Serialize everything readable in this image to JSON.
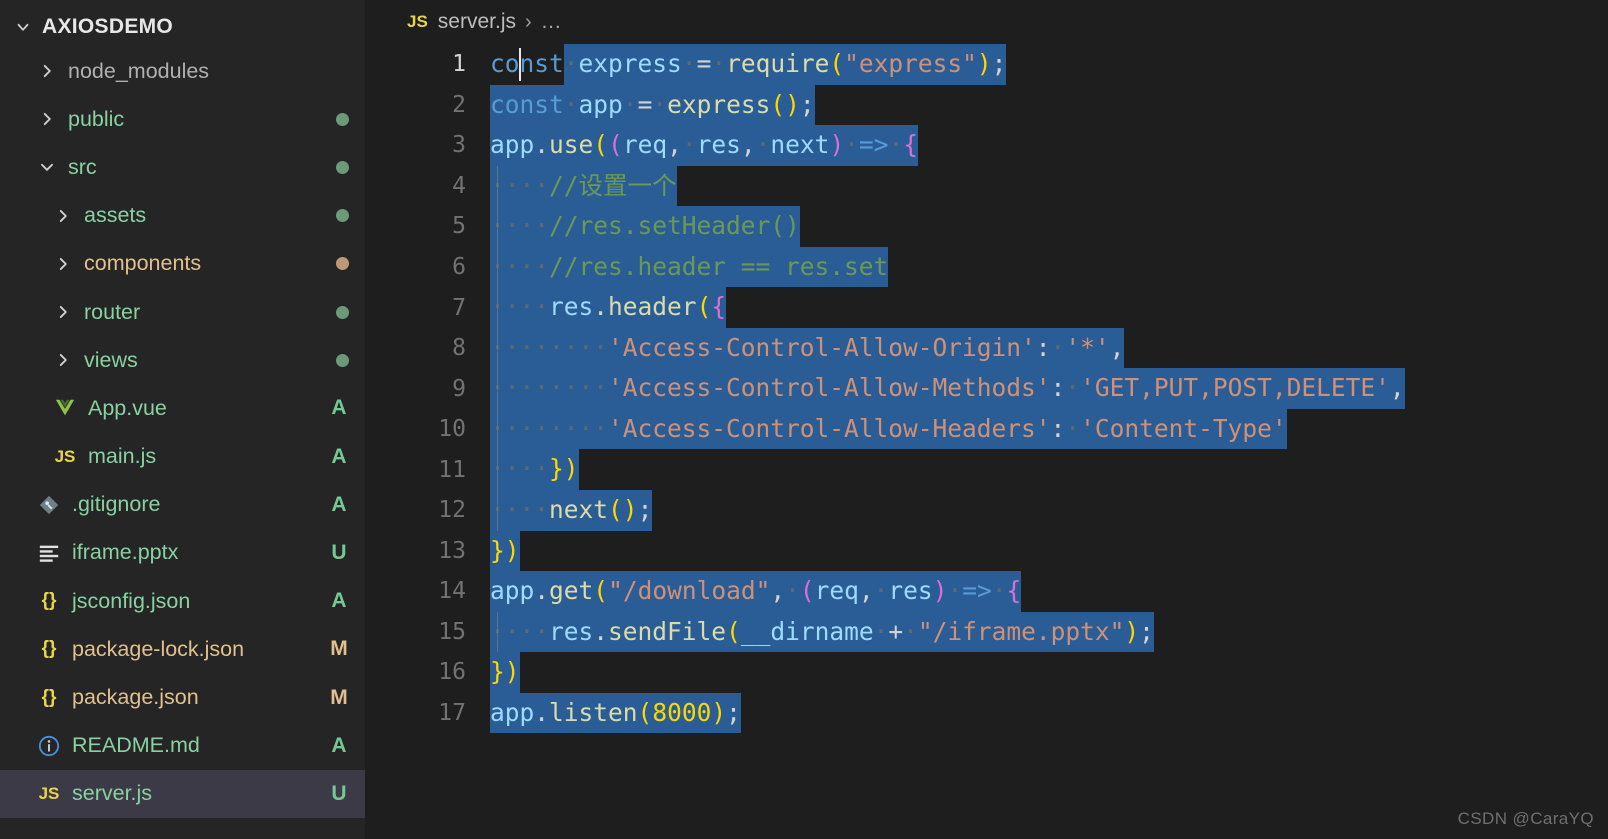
{
  "sidebar": {
    "root_label": "AXIOSDEMO",
    "root_twisty": "chevron-down-icon",
    "items": [
      {
        "label": "node_modules",
        "type": "folder",
        "twisty": "chevron-right-icon",
        "indent": 1,
        "name_color": "#b0b0b0",
        "dot": null,
        "status": null,
        "icon": null,
        "selected": false
      },
      {
        "label": "public",
        "type": "folder",
        "twisty": "chevron-right-icon",
        "indent": 1,
        "name_color": "#89d1a0",
        "dot": "#6a9a78",
        "status": null,
        "icon": null,
        "selected": false
      },
      {
        "label": "src",
        "type": "folder",
        "twisty": "chevron-down-icon",
        "indent": 1,
        "name_color": "#89d1a0",
        "dot": "#6a9a78",
        "status": null,
        "icon": null,
        "selected": false
      },
      {
        "label": "assets",
        "type": "folder",
        "twisty": "chevron-right-icon",
        "indent": 2,
        "name_color": "#89d1a0",
        "dot": "#6a9a78",
        "status": null,
        "icon": null,
        "selected": false
      },
      {
        "label": "components",
        "type": "folder",
        "twisty": "chevron-right-icon",
        "indent": 2,
        "name_color": "#e2c08d",
        "dot": "#bf9875",
        "status": null,
        "icon": null,
        "selected": false
      },
      {
        "label": "router",
        "type": "folder",
        "twisty": "chevron-right-icon",
        "indent": 2,
        "name_color": "#89d1a0",
        "dot": "#6a9a78",
        "status": null,
        "icon": null,
        "selected": false
      },
      {
        "label": "views",
        "type": "folder",
        "twisty": "chevron-right-icon",
        "indent": 2,
        "name_color": "#89d1a0",
        "dot": "#6a9a78",
        "status": null,
        "icon": null,
        "selected": false
      },
      {
        "label": "App.vue",
        "type": "file",
        "twisty": null,
        "indent": 2,
        "name_color": "#89d1a0",
        "dot": null,
        "status": "A",
        "status_color": "#73c991",
        "icon": "vue-icon",
        "selected": false
      },
      {
        "label": "main.js",
        "type": "file",
        "twisty": null,
        "indent": 2,
        "name_color": "#89d1a0",
        "dot": null,
        "status": "A",
        "status_color": "#73c991",
        "icon": "js-icon",
        "selected": false
      },
      {
        "label": ".gitignore",
        "type": "file",
        "twisty": null,
        "indent": 1,
        "name_color": "#89d1a0",
        "dot": null,
        "status": "A",
        "status_color": "#73c991",
        "icon": "git-icon",
        "selected": false
      },
      {
        "label": "iframe.pptx",
        "type": "file",
        "twisty": null,
        "indent": 1,
        "name_color": "#89d1a0",
        "dot": null,
        "status": "U",
        "status_color": "#73c991",
        "icon": "powerpoint-icon",
        "selected": false
      },
      {
        "label": "jsconfig.json",
        "type": "file",
        "twisty": null,
        "indent": 1,
        "name_color": "#89d1a0",
        "dot": null,
        "status": "A",
        "status_color": "#73c991",
        "icon": "json-icon",
        "selected": false
      },
      {
        "label": "package-lock.json",
        "type": "file",
        "twisty": null,
        "indent": 1,
        "name_color": "#e2c08d",
        "dot": null,
        "status": "M",
        "status_color": "#e2c08d",
        "icon": "json-icon",
        "selected": false
      },
      {
        "label": "package.json",
        "type": "file",
        "twisty": null,
        "indent": 1,
        "name_color": "#e2c08d",
        "dot": null,
        "status": "M",
        "status_color": "#e2c08d",
        "icon": "json-icon",
        "selected": false
      },
      {
        "label": "README.md",
        "type": "file",
        "twisty": null,
        "indent": 1,
        "name_color": "#89d1a0",
        "dot": null,
        "status": "A",
        "status_color": "#73c991",
        "icon": "info-icon",
        "selected": false
      },
      {
        "label": "server.js",
        "type": "file",
        "twisty": null,
        "indent": 1,
        "name_color": "#89d1a0",
        "dot": null,
        "status": "U",
        "status_color": "#73c991",
        "icon": "js-icon",
        "selected": true
      }
    ]
  },
  "breadcrumb": {
    "file_icon": "js-icon",
    "file_icon_label": "JS",
    "file": "server.js",
    "separator": "›",
    "overflow": "…"
  },
  "editor": {
    "language": "javascript",
    "filename": "server.js",
    "active_line": 1,
    "cursor": {
      "line": 1,
      "column": 3
    },
    "selection_color": "#2a5d96",
    "background": "#1e1e1e",
    "line_numbers": [
      "1",
      "2",
      "3",
      "4",
      "5",
      "6",
      "7",
      "8",
      "9",
      "10",
      "11",
      "12",
      "13",
      "14",
      "15",
      "16",
      "17"
    ],
    "lines": [
      "const express = require(\"express\");",
      "const app = express();",
      "app.use((req, res, next) => {",
      "    //设置一个",
      "    //res.setHeader()",
      "    //res.header == res.set",
      "    res.header({",
      "        'Access-Control-Allow-Origin': '*',",
      "        'Access-Control-Allow-Methods': 'GET,PUT,POST,DELETE',",
      "        'Access-Control-Allow-Headers': 'Content-Type'",
      "    })",
      "    next();",
      "})",
      "app.get(\"/download\", (req, res) => {",
      "    res.sendFile(__dirname + \"/iframe.pptx\");",
      "})",
      "app.listen(8000);"
    ]
  },
  "watermark": {
    "text": "CSDN @CaraYQ"
  },
  "colors": {
    "sidebar_bg": "#252526",
    "editor_bg": "#1e1e1e",
    "selection": "#2a5d96",
    "keyword": "#569cd6",
    "variable": "#9cdcfe",
    "function": "#dcdcaa",
    "string": "#ce9178",
    "comment": "#6a9955",
    "bracket1": "#ffd700",
    "bracket2": "#da70d6",
    "bracket3": "#179fff",
    "status_added": "#73c991",
    "status_modified": "#e2c08d",
    "row_selected_bg": "#3b3a46"
  }
}
